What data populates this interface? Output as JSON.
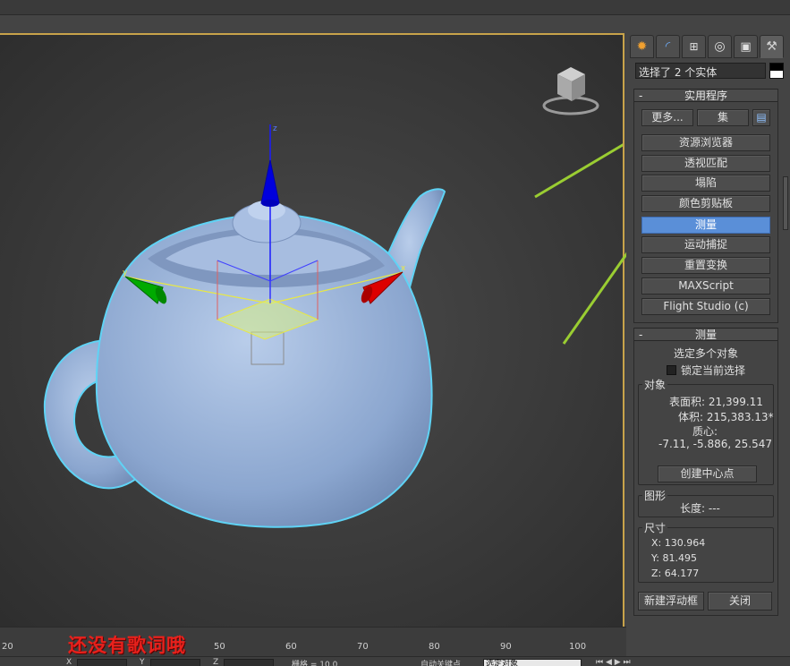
{
  "selection_field": {
    "text": "选择了 2 个实体"
  },
  "command_tabs": [
    {
      "name": "create-tab",
      "icon": "sun-star-icon"
    },
    {
      "name": "modify-tab",
      "icon": "curve-icon"
    },
    {
      "name": "hierarchy-tab",
      "icon": "hierarchy-icon"
    },
    {
      "name": "motion-tab",
      "icon": "motion-circle-icon"
    },
    {
      "name": "display-tab",
      "icon": "monitor-icon"
    },
    {
      "name": "utilities-tab",
      "icon": "hammer-icon",
      "active": true
    }
  ],
  "utilities_rollout": {
    "title": "实用程序",
    "more_button": "更多...",
    "sets_button": "集",
    "buttons": [
      "资源浏览器",
      "透视匹配",
      "塌陷",
      "颜色剪贴板",
      "测量",
      "运动捕捉",
      "重置变换",
      "MAXScript",
      "Flight Studio (c)"
    ],
    "selected_button": "测量"
  },
  "measure_rollout": {
    "title": "测量",
    "multiple_objects": "选定多个对象",
    "lock_selection": "锁定当前选择",
    "objects_group": {
      "title": "对象",
      "surface_area": "表面积: 21,399.11",
      "volume": "体积: 215,383.13*",
      "center_mass_label": "质心:",
      "center_mass_value": "-7.11, -5.886, 25.547",
      "create_center_button": "创建中心点"
    },
    "shapes_group": {
      "title": "图形",
      "length": "长度: ---"
    },
    "dimensions_group": {
      "title": "尺寸",
      "x": "X:   130.964",
      "y": "Y:   81.495",
      "z": "Z:   64.177"
    },
    "new_floater_button": "新建浮动框",
    "close_button": "关闭"
  },
  "timeline": {
    "ticks": [
      "20",
      "50",
      "60",
      "70",
      "80",
      "90",
      "100"
    ]
  },
  "lyrics_overlay": "还没有歌词哦",
  "status_bar": {
    "x_label": "X",
    "y_label": "Y",
    "z_label": "Z",
    "grid_label": "栅格 = 10.0",
    "auto_key": "自动关键点",
    "selection_set": "选定对象"
  },
  "colors": {
    "accent_arrow": "#9acd32",
    "selected_button": "#5a8fd8",
    "teapot": "#9fb8dc",
    "gizmo_blue": "#0000dd",
    "gizmo_green": "#00aa00",
    "gizmo_red": "#dd0000"
  }
}
